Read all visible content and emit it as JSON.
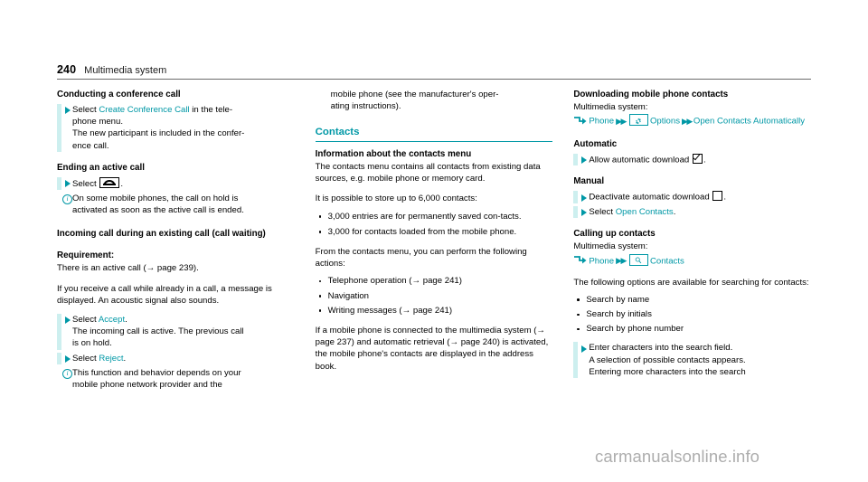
{
  "header": {
    "page_number": "240",
    "chapter": "Multimedia system"
  },
  "watermark": "carmanualsonline.info",
  "colors": {
    "accent_teal": "#0098a6",
    "accent_bar": "#cdefef",
    "watermark_gray": "#adadad"
  },
  "left_column": {
    "heading_conference": "Conducting a conference call",
    "action_conference": {
      "select_label": "Select",
      "link": "Create Conference Call",
      "tail": "in the tele-",
      "line2": "phone menu.",
      "line3": "The new participant is included in the confer-",
      "line4": "ence call."
    },
    "heading_ending": "Ending an active call",
    "action_ending": {
      "select_label": "Select",
      "icon": "phone-hangup-icon",
      "tail": "."
    },
    "note_hold": {
      "icon": "info-circle-icon",
      "line1": "On some mobile phones, the call on hold is",
      "line2": "activated as soon as the active call is ended."
    },
    "heading_incoming": "Incoming call during an existing call (call waiting)",
    "heading_requirement": "Requirement:",
    "para_requirement": "There is an active call (→ page 239).",
    "para_receive": "If you receive a call while already in a call, a message is displayed. An acoustic signal also sounds.",
    "action_accept": {
      "select_label": "Select",
      "link": "Accept",
      "tail": ".",
      "line2": "The incoming call is active. The previous call",
      "line3": "is on hold."
    },
    "action_reject": {
      "select_label": "Select",
      "link": "Reject",
      "tail": "."
    },
    "note_provider": {
      "icon": "info-circle-icon",
      "line1": "This function and behavior depends on your",
      "line2": "mobile phone network provider and the"
    }
  },
  "middle_column": {
    "continuation_line1": "mobile phone (see the manufacturer's oper-",
    "continuation_line2": "ating instructions).",
    "section_heading": "Contacts",
    "heading_info": "Information about the contacts menu",
    "para_menu": "The contacts menu contains all contacts from existing data sources, e.g. mobile phone or memory card.",
    "para_store": "It is possible to store up to 6,000 contacts:",
    "bullets_capacity": [
      "3,000 entries are for permanently saved con-tacts.",
      "3,000 for contacts loaded from the mobile phone."
    ],
    "para_actions": "From the contacts menu, you can perform the following actions:",
    "bullets_actions": [
      "Telephone operation (→ page 241)",
      "Navigation",
      "Writing messages (→ page 241)"
    ],
    "para_connected": "If a mobile phone is connected to the multimedia system (→ page 237) and automatic retrieval (→ page 240) is activated, the mobile phone's contacts are displayed in the address book."
  },
  "right_column": {
    "heading_downloading": "Downloading mobile phone contacts",
    "label_mm_system_1": "Multimedia system:",
    "path_download": {
      "arrow_icon": "step-arrow-icon",
      "item1": "Phone",
      "sep1": "▶▶",
      "gear_icon": "gear-icon",
      "item2": "Options",
      "sep2": "▶▶",
      "item3": "Open Contacts Automatically"
    },
    "heading_automatic": "Automatic",
    "action_allow": {
      "text": "Allow automatic download",
      "icon": "checkbox-checked-icon",
      "tail": "."
    },
    "heading_manual": "Manual",
    "action_deactivate": {
      "text": "Deactivate automatic download",
      "icon": "checkbox-unchecked-icon",
      "tail": "."
    },
    "action_open_contacts": {
      "select_label": "Select",
      "link": "Open Contacts",
      "tail": "."
    },
    "heading_calling": "Calling up contacts",
    "label_mm_system_2": "Multimedia system:",
    "path_contacts": {
      "arrow_icon": "step-arrow-icon",
      "item1": "Phone",
      "sep1": "▶▶",
      "magnifier_icon": "magnifier-icon",
      "item2": "Contacts"
    },
    "para_options": "The following options are available for searching for contacts:",
    "bullets_search": [
      "Search by name",
      "Search by initials",
      "Search by phone number"
    ],
    "action_enter": {
      "line1": "Enter characters into the search field.",
      "line2": "A selection of possible contacts appears.",
      "line3": "Entering more characters into the search"
    }
  }
}
